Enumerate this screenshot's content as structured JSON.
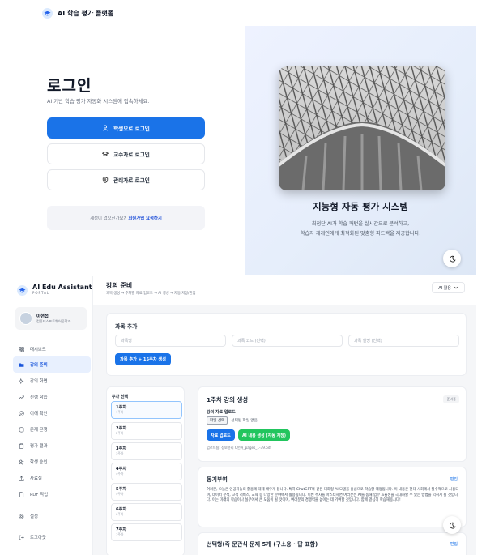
{
  "header": {
    "brand": "AI 학습 평가 플랫폼"
  },
  "login": {
    "title": "로그인",
    "subtitle": "AI 기반 학습 평가 자동화 시스템에 접속하세요.",
    "buttons": {
      "student": "학생으로 로그인",
      "professor": "교수자로 로그인",
      "admin": "관리자로 로그인"
    },
    "signup_prompt": "계정이 없으신가요?",
    "signup_link": "회원가입 요청하기",
    "hero_title": "지능형 자동 평가 시스템",
    "hero_desc_line1": "최첨단 AI가 학습 패턴을 실시간으로 분석하고,",
    "hero_desc_line2": "학습자 개개인에게 최적화된 맞춤형 피드백을 제공합니다."
  },
  "app": {
    "brand": {
      "title": "AI Edu Assistant",
      "subtitle": "PORTAL"
    },
    "user": {
      "name": "이현섭",
      "dept": "컴퓨터소프트웨어공학과"
    },
    "nav": [
      {
        "label": "대시보드",
        "icon": "grid-icon"
      },
      {
        "label": "강의 준비",
        "icon": "folder-icon"
      },
      {
        "label": "강의 화면",
        "icon": "sparkle-icon"
      },
      {
        "label": "진행 학습",
        "icon": "trend-icon"
      },
      {
        "label": "이해 확인",
        "icon": "check-circle-icon"
      },
      {
        "label": "문제 은행",
        "icon": "database-icon"
      },
      {
        "label": "평가 결과",
        "icon": "clipboard-icon"
      },
      {
        "label": "학생 승인",
        "icon": "user-plus-icon"
      },
      {
        "label": "자료실",
        "icon": "upload-icon"
      },
      {
        "label": "PDF 작업",
        "icon": "file-icon"
      },
      {
        "label": "설정",
        "icon": "gear-icon"
      }
    ],
    "logout": "로그아웃",
    "page_title": "강의 준비",
    "breadcrumb": "과목 생성 → 주차별 자료 업로드 → AI 생성 → 자동 저장/편집",
    "ai_toggle": "AI 활용",
    "add_course": {
      "title": "과목 추가",
      "name_placeholder": "과목명",
      "code_placeholder": "과목 코드 (선택)",
      "desc_placeholder": "과목 설명 (선택)",
      "button": "과목 추가 + 15주차 생성"
    },
    "week_select": {
      "title": "주차 선택",
      "weeks": [
        {
          "label": "1주차",
          "sub": "1주차"
        },
        {
          "label": "2주차",
          "sub": "2주차"
        },
        {
          "label": "3주차",
          "sub": "3주차"
        },
        {
          "label": "4주차",
          "sub": "4주차"
        },
        {
          "label": "5주차",
          "sub": "5주차"
        },
        {
          "label": "6주차",
          "sub": "6주차"
        },
        {
          "label": "7주차",
          "sub": "7주차"
        }
      ]
    },
    "generate": {
      "title": "1주차 강의 생성",
      "badge": "준비중",
      "upload_label": "강의 자료 업로드",
      "file_button": "파일 선택",
      "file_none": "선택된 파일 없음",
      "upload_button": "자료 업로드",
      "ai_button": "AI 내용 생성 (자동 저장)",
      "uploaded": "업로드됨: 정보윤리 C언어_pages_1-39.pdf"
    },
    "motivation": {
      "title": "동기부여",
      "edit": "편집",
      "body": "여러분, 오늘은 인공지능의 활용에 대해 배우게 됩니다. 특히 ChatGPT와 같은 대화형 AI 모델을 중심으로 학습할 예정입니다. 이 내용은 현대 사회에서 필수적으로 사용되며, 데이터 분석, 고객 서비스, 교육 등 다양한 분야에서 활용됩니다. 이번 주차를 마스터하면 여러분은 AI를 통해 업무 효율성을 극대화할 수 있는 방법을 익히게 될 것입니다. 이는 미래의 학습이나 실무에서 큰 도움이 될 것이며, 여러분의 경쟁력을 높이는 데 기여할 것입니다. 함께 열심히 학습해봅시다!"
    },
    "quiz": {
      "title": "선택형(즉 문관식 문제 5개 (구소용 · 답 표함)",
      "edit": "편집"
    }
  }
}
